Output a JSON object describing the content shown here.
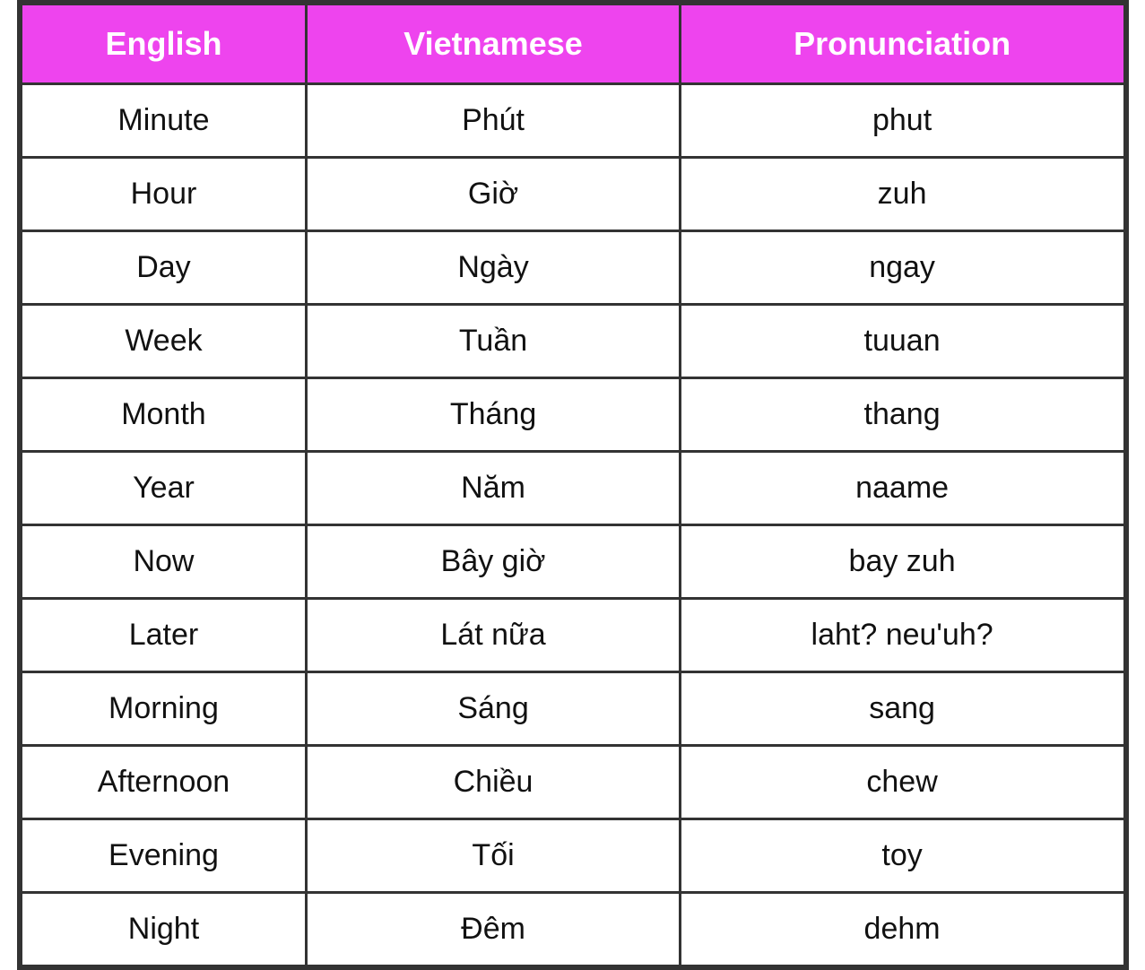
{
  "table": {
    "headers": [
      {
        "label": "English",
        "id": "col-english"
      },
      {
        "label": "Vietnamese",
        "id": "col-vietnamese"
      },
      {
        "label": "Pronunciation",
        "id": "col-pronunciation"
      }
    ],
    "rows": [
      {
        "english": "Minute",
        "vietnamese": "Phút",
        "pronunciation": "phut"
      },
      {
        "english": "Hour",
        "vietnamese": "Giờ",
        "pronunciation": "zuh"
      },
      {
        "english": "Day",
        "vietnamese": "Ngày",
        "pronunciation": "ngay"
      },
      {
        "english": "Week",
        "vietnamese": "Tuần",
        "pronunciation": "tuuan"
      },
      {
        "english": "Month",
        "vietnamese": "Tháng",
        "pronunciation": "thang"
      },
      {
        "english": "Year",
        "vietnamese": "Năm",
        "pronunciation": "naame"
      },
      {
        "english": "Now",
        "vietnamese": "Bây giờ",
        "pronunciation": "bay zuh"
      },
      {
        "english": "Later",
        "vietnamese": "Lát nữa",
        "pronunciation": "laht? neu'uh?"
      },
      {
        "english": "Morning",
        "vietnamese": "Sáng",
        "pronunciation": "sang"
      },
      {
        "english": "Afternoon",
        "vietnamese": "Chiều",
        "pronunciation": "chew"
      },
      {
        "english": "Evening",
        "vietnamese": "Tối",
        "pronunciation": "toy"
      },
      {
        "english": "Night",
        "vietnamese": "Đêm",
        "pronunciation": "dehm"
      }
    ],
    "accent_color": "#ee44ee"
  }
}
